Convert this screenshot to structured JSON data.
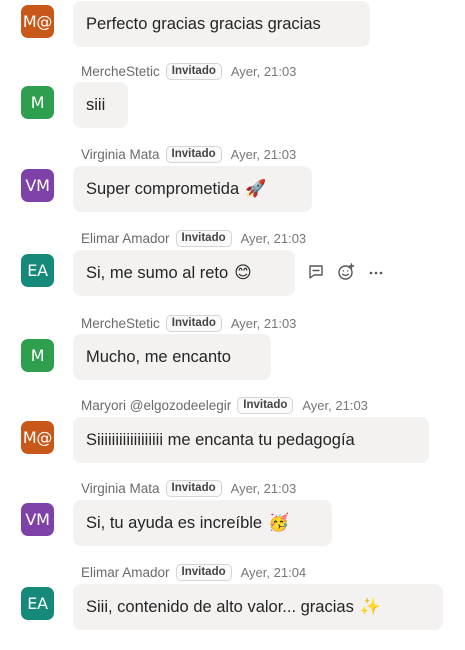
{
  "colors": {
    "avatar_orange": "#C8581A",
    "avatar_green": "#2E9E4F",
    "avatar_purple": "#7E41A8",
    "avatar_teal": "#15897A",
    "bubble_bg": "#F3F2F1"
  },
  "badge_label": "Invitado",
  "messages": [
    {
      "initials": "M@",
      "text": "Perfecto gracias gracias gracias"
    },
    {
      "initials": "M",
      "author": "MercheStetic",
      "time": "Ayer, 21:03",
      "text": "siii"
    },
    {
      "initials": "VM",
      "author": "Virginia Mata",
      "time": "Ayer, 21:03",
      "text": "Super comprometida",
      "emoji": "🚀"
    },
    {
      "initials": "EA",
      "author": "Elimar Amador",
      "time": "Ayer, 21:03",
      "text": "Si, me sumo al reto",
      "emoji": "😊"
    },
    {
      "initials": "M",
      "author": "MercheStetic",
      "time": "Ayer, 21:03",
      "text": "Mucho, me encanto"
    },
    {
      "initials": "M@",
      "author": "Maryori @elgozodeelegir",
      "time": "Ayer, 21:03",
      "text": "Siiiiiiiiiiiiiiiiii me encanta tu pedagogía"
    },
    {
      "initials": "VM",
      "author": "Virginia Mata",
      "time": "Ayer, 21:03",
      "text": "Si, tu ayuda es increíble",
      "emoji": "🥳"
    },
    {
      "initials": "EA",
      "author": "Elimar Amador",
      "time": "Ayer, 21:04",
      "text": "Siii, contenido de alto valor... gracias",
      "emoji": "✨"
    }
  ],
  "hover_actions": {
    "reply_icon": "reply-icon",
    "react_icon": "add-reaction-icon",
    "more_icon": "more-options-icon"
  }
}
